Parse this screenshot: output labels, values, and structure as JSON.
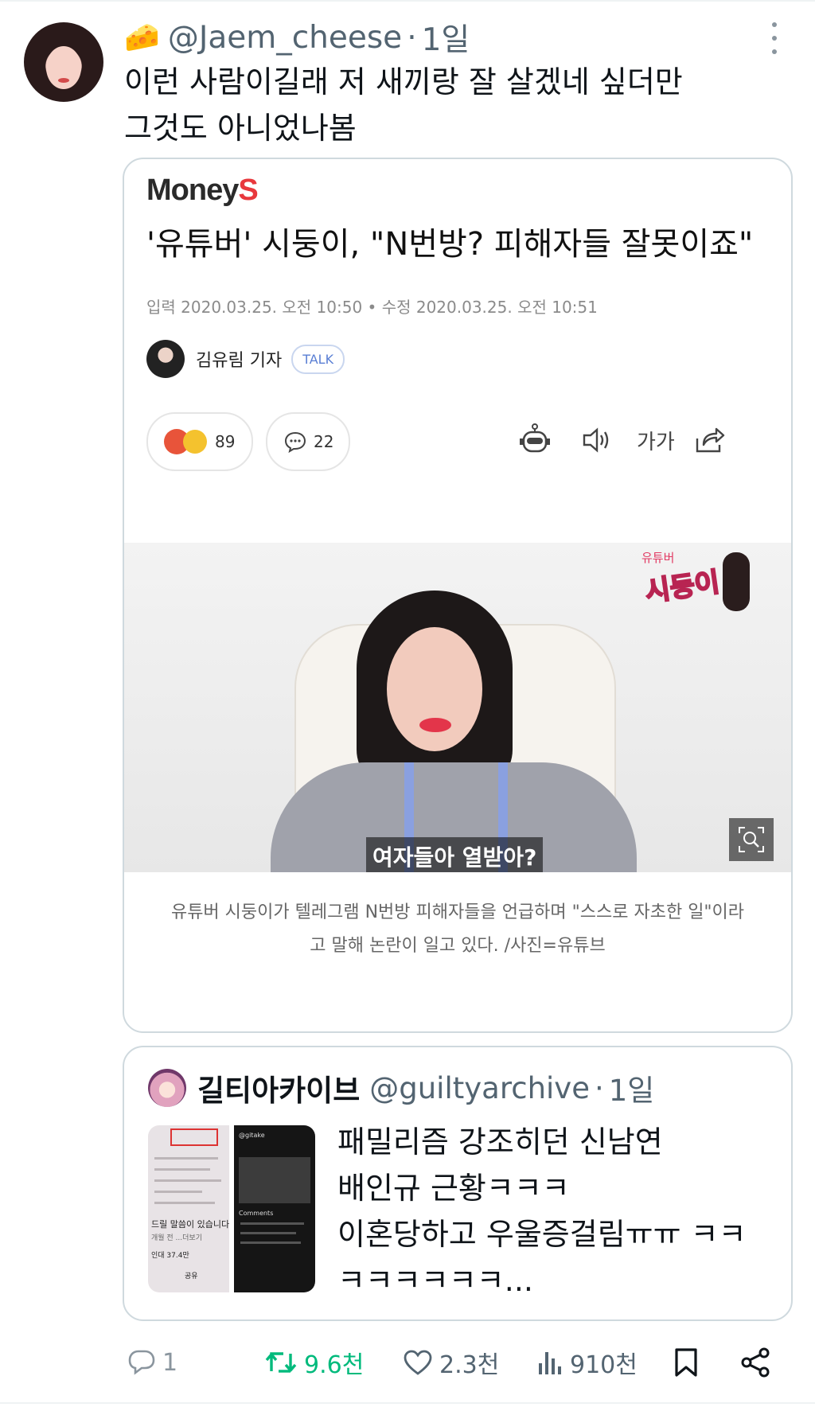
{
  "tweet": {
    "handle": "@Jaem_cheese",
    "separator": "·",
    "time": "1일",
    "emoji": "🧀",
    "text_lines": [
      "이런 사람이길래 저 새끼랑 잘 살겠네 싶더만",
      "그것도 아니었나봄"
    ]
  },
  "article_card": {
    "logo_main": "Money",
    "logo_accent": "S",
    "headline": "'유튜버' 시둥이, \"N번방? 피해자들 잘못이죠\"",
    "dateline": "입력 2020.03.25. 오전 10:50 • 수정 2020.03.25. 오전 10:51",
    "reporter_name": "김유림 기자",
    "talk_label": "TALK",
    "reaction_count": "89",
    "comment_count": "22",
    "font_size_label": "가가",
    "image_subtitle": "여자들아 열받아?",
    "sticker_top": "유튜버",
    "sticker_text": "시둥이",
    "caption_lines": [
      "유튜버 시둥이가 텔레그램 N번방 피해자들을 언급하며 \"스스로 자초한 일\"이라",
      "고 말해 논란이 일고 있다. /사진=유튜브"
    ]
  },
  "quoted_tweet": {
    "display_name": "길티아카이브",
    "handle": "@guiltyarchive",
    "separator": "·",
    "time": "1일",
    "text_lines": [
      "패밀리즘 강조히던 신남연",
      "배인규 근황ㅋㅋㅋ",
      "이혼당하고 우울증걸림ㅠㅠ ㅋㅋ",
      "ㅋㅋㅋㅋㅋㅋ..."
    ],
    "thumb_text_1": "드릴 말씀이 있습니다.",
    "thumb_text_2": "개월 전 ...더보기",
    "thumb_text_3": "인대 37.4만",
    "thumb_text_4": "공유",
    "thumb2_handle": "@gitake",
    "thumb2_comments": "Comments"
  },
  "actions": {
    "replies": "1",
    "retweets": "9.6천",
    "likes": "2.3천",
    "views": "910천"
  },
  "colors": {
    "retweet_active": "#00ba7c",
    "secondary_text": "#536471",
    "border": "#cfd9de",
    "brand_accent": "#e8383d"
  }
}
